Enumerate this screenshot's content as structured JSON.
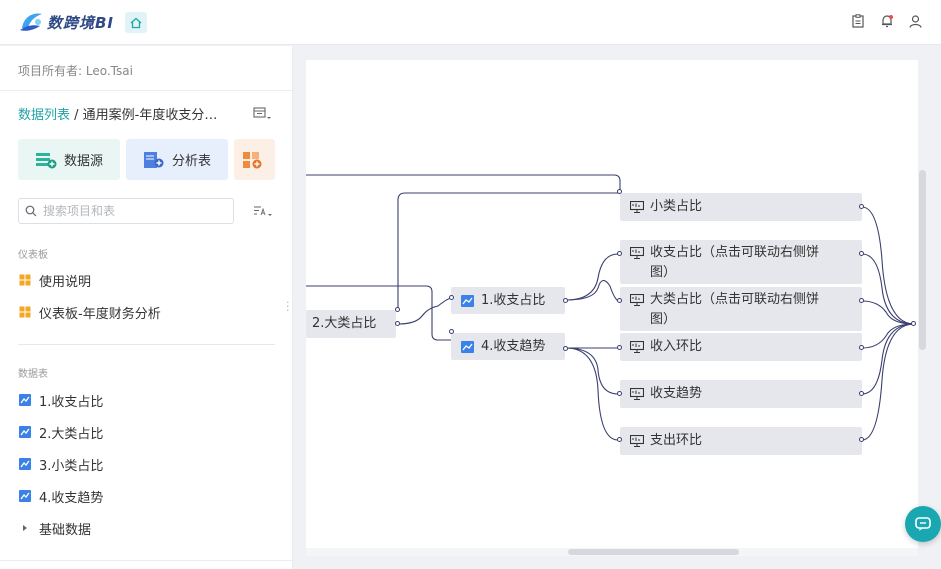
{
  "app": {
    "brand": "数跨境BI"
  },
  "sidebar": {
    "owner": "项目所有者: Leo.Tsai",
    "breadcrumb": {
      "root": "数据列表",
      "sep": " / ",
      "current": "通用案例-年度收支分…"
    },
    "tiles": [
      {
        "label": "数据源",
        "color": "#eaf6f4"
      },
      {
        "label": "分析表",
        "color": "#e6effb"
      },
      {
        "label": "",
        "color": "#fcefe6"
      }
    ],
    "search": {
      "placeholder": "搜索项目和表"
    },
    "dashboards": {
      "title": "仪表板",
      "items": [
        {
          "label": "使用说明"
        },
        {
          "label": "仪表板-年度财务分析"
        }
      ]
    },
    "tables": {
      "title": "数据表",
      "items": [
        {
          "label": "1.收支占比"
        },
        {
          "label": "2.大类占比"
        },
        {
          "label": "3.小类占比"
        },
        {
          "label": "4.收支趋势"
        },
        {
          "label": "基础数据"
        }
      ]
    }
  },
  "flow": {
    "nodes": {
      "n2": {
        "label": "2.大类占比"
      },
      "n1": {
        "label": "1.收支占比"
      },
      "n4": {
        "label": "4.收支趋势"
      },
      "c1": {
        "label": "小类占比"
      },
      "c2": {
        "label": "收支占比（点击可联动右侧饼图）"
      },
      "c3": {
        "label": "大类占比（点击可联动右侧饼图）"
      },
      "c4": {
        "label": "收入环比"
      },
      "c5": {
        "label": "收支趋势"
      },
      "c6": {
        "label": "支出环比"
      }
    }
  },
  "colors": {
    "accent": "#22a3a8",
    "brand": "#2f4a86",
    "link_line": "#3a3f6e",
    "node_bg": "#e6e7ec"
  }
}
